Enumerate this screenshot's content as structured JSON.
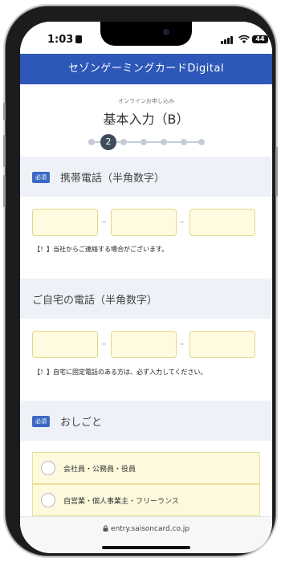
{
  "status": {
    "time": "1:03",
    "battery": "44"
  },
  "header": {
    "title": "セゾンゲーミングカードDigital"
  },
  "page": {
    "subtitle": "オンラインお申し込み",
    "title": "基本入力（B）",
    "current_step": "2"
  },
  "mobile_phone": {
    "required_badge": "必須",
    "label": "携帯電話（半角数字）",
    "separator": "–",
    "note": "【！】当社からご連絡する場合がございます。"
  },
  "home_phone": {
    "label": "ご自宅の電話（半角数字）",
    "separator": "–",
    "note": "【！】自宅に固定電話のある方は、必ず入力してください。"
  },
  "occupation": {
    "required_badge": "必須",
    "label": "おしごと",
    "options": [
      "会社員・公務員・役員",
      "自営業・個人事業主・フリーランス"
    ]
  },
  "browser": {
    "url": "entry.saisoncard.co.jp"
  }
}
